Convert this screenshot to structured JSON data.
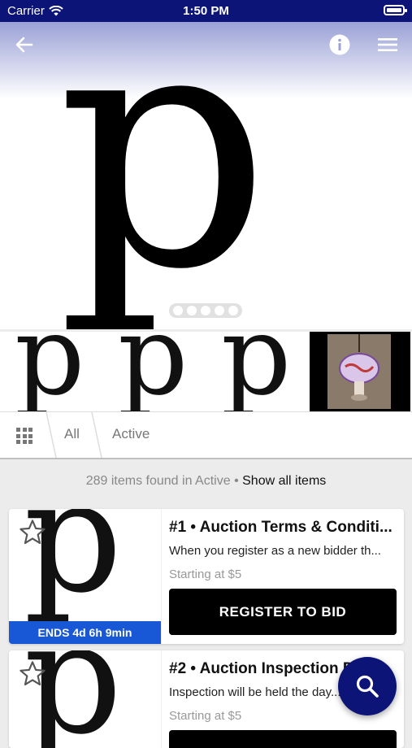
{
  "status_bar": {
    "carrier": "Carrier",
    "time": "1:50 PM"
  },
  "hero": {
    "letter": "p",
    "page_count": 5
  },
  "thumbnails": [
    {
      "letter": "p"
    },
    {
      "letter": "p"
    },
    {
      "letter": "p"
    }
  ],
  "filters": {
    "all": "All",
    "active": "Active"
  },
  "results": {
    "count_text": "289 items found in",
    "filter_name": "Active",
    "separator": "•",
    "show_all": "Show all items"
  },
  "items": [
    {
      "title": "#1 • Auction Terms & Conditi...",
      "description": "When you register as a new bidder th...",
      "price": "Starting at $5",
      "ends": "ENDS 4d 6h 9min",
      "button": "REGISTER TO BID",
      "letter": "p"
    },
    {
      "title": "#2 • Auction Inspection D...",
      "description": "Inspection will be held the day...",
      "price": "Starting at $5",
      "letter": "p"
    }
  ],
  "colors": {
    "brand": "#0d1478",
    "ends_bar": "#1858d6"
  },
  "icons": {
    "back": "arrow-left-icon",
    "info": "info-icon",
    "menu": "hamburger-menu-icon",
    "search": "search-icon",
    "favorite": "star-outline-icon",
    "grid": "grid-icon"
  }
}
